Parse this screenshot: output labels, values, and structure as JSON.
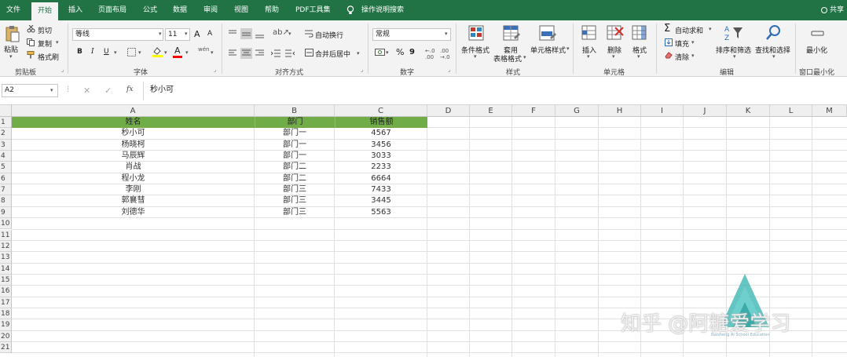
{
  "menu": {
    "tabs": [
      "文件",
      "开始",
      "插入",
      "页面布局",
      "公式",
      "数据",
      "审阅",
      "视图",
      "帮助",
      "PDF工具集"
    ],
    "search": "操作说明搜索",
    "share": "共享"
  },
  "ribbon": {
    "clipboard": {
      "paste": "粘贴",
      "cut": "剪切",
      "copy": "复制",
      "format_painter": "格式刷",
      "label": "剪贴板"
    },
    "font": {
      "name": "等线",
      "size": "11",
      "grow": "A",
      "shrink": "A",
      "bold": "B",
      "italic": "I",
      "underline": "U",
      "font_color": "A",
      "wen": "wén",
      "label": "字体"
    },
    "align": {
      "wrap": "自动换行",
      "merge": "合并后居中",
      "label": "对齐方式"
    },
    "number": {
      "format": "常规",
      "percent": "%",
      "comma": "9",
      "label": "数字"
    },
    "styles": {
      "conditional": "条件格式",
      "table_line1": "套用",
      "table_line2": "表格格式",
      "cell_styles": "单元格样式",
      "label": "样式"
    },
    "cells": {
      "insert": "插入",
      "delete": "删除",
      "format": "格式",
      "label": "单元格"
    },
    "editing": {
      "autosum": "自动求和",
      "fill": "填充",
      "clear": "清除",
      "sort": "排序和筛选",
      "find": "查找和选择",
      "label": "编辑"
    },
    "window": {
      "minimize": "最小化",
      "label": "窗口最小化"
    }
  },
  "formula_bar": {
    "name_box": "A2",
    "formula": "秒小可",
    "fx": "fx"
  },
  "sheet": {
    "columns": [
      "A",
      "B",
      "C",
      "D",
      "E",
      "F",
      "G",
      "H",
      "I",
      "J",
      "K",
      "L",
      "M"
    ],
    "header_row": [
      "姓名",
      "部门",
      "销售额"
    ],
    "rows": [
      [
        "秒小可",
        "部门一",
        "4567"
      ],
      [
        "杨晓柯",
        "部门一",
        "3456"
      ],
      [
        "马辰辉",
        "部门一",
        "3033"
      ],
      [
        "肖战",
        "部门二",
        "2233"
      ],
      [
        "程小龙",
        "部门二",
        "6664"
      ],
      [
        "李刚",
        "部门三",
        "7433"
      ],
      [
        "郭襄彗",
        "部门三",
        "3445"
      ],
      [
        "刘德华",
        "部门三",
        "5563"
      ]
    ],
    "row_numbers": [
      "1",
      "2",
      "3",
      "4",
      "5",
      "6",
      "7",
      "8",
      "9",
      "10",
      "11",
      "12",
      "13",
      "14",
      "15",
      "16",
      "17",
      "18",
      "19",
      "20",
      "21"
    ],
    "header_color": "#70ad47"
  },
  "watermark": {
    "text": "知乎 @阿糖爱学习",
    "small": "Naisheng Ai School Education"
  },
  "colors": {
    "brand": "#217346",
    "header_fill": "#70ad47"
  }
}
